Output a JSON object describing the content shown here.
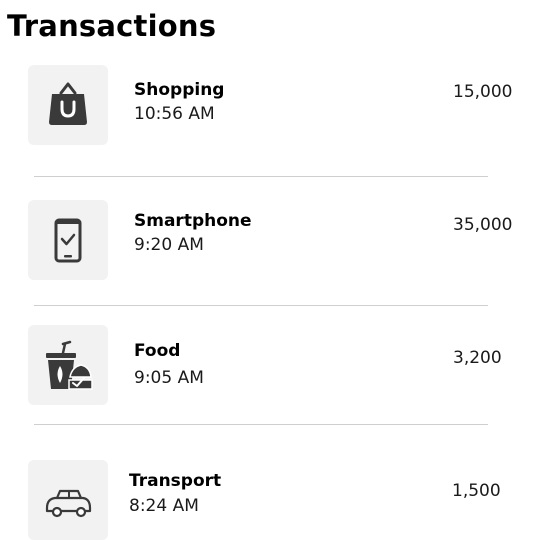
{
  "header": {
    "title": "Transactions"
  },
  "transactions": [
    {
      "name": "Shopping",
      "time": "10:56 AM",
      "amount": "15,000",
      "icon": "shopping-bag-icon"
    },
    {
      "name": "Smartphone",
      "time": "9:20 AM",
      "amount": "35,000",
      "icon": "smartphone-icon"
    },
    {
      "name": "Food",
      "time": "9:05 AM",
      "amount": "3,200",
      "icon": "food-drink-icon"
    },
    {
      "name": "Transport",
      "time": "8:24 AM",
      "amount": "1,500",
      "icon": "taxi-icon"
    }
  ],
  "colors": {
    "icon": "#3a3a3a",
    "tile": "#f2f2f2",
    "divider": "#cfcfcf"
  }
}
